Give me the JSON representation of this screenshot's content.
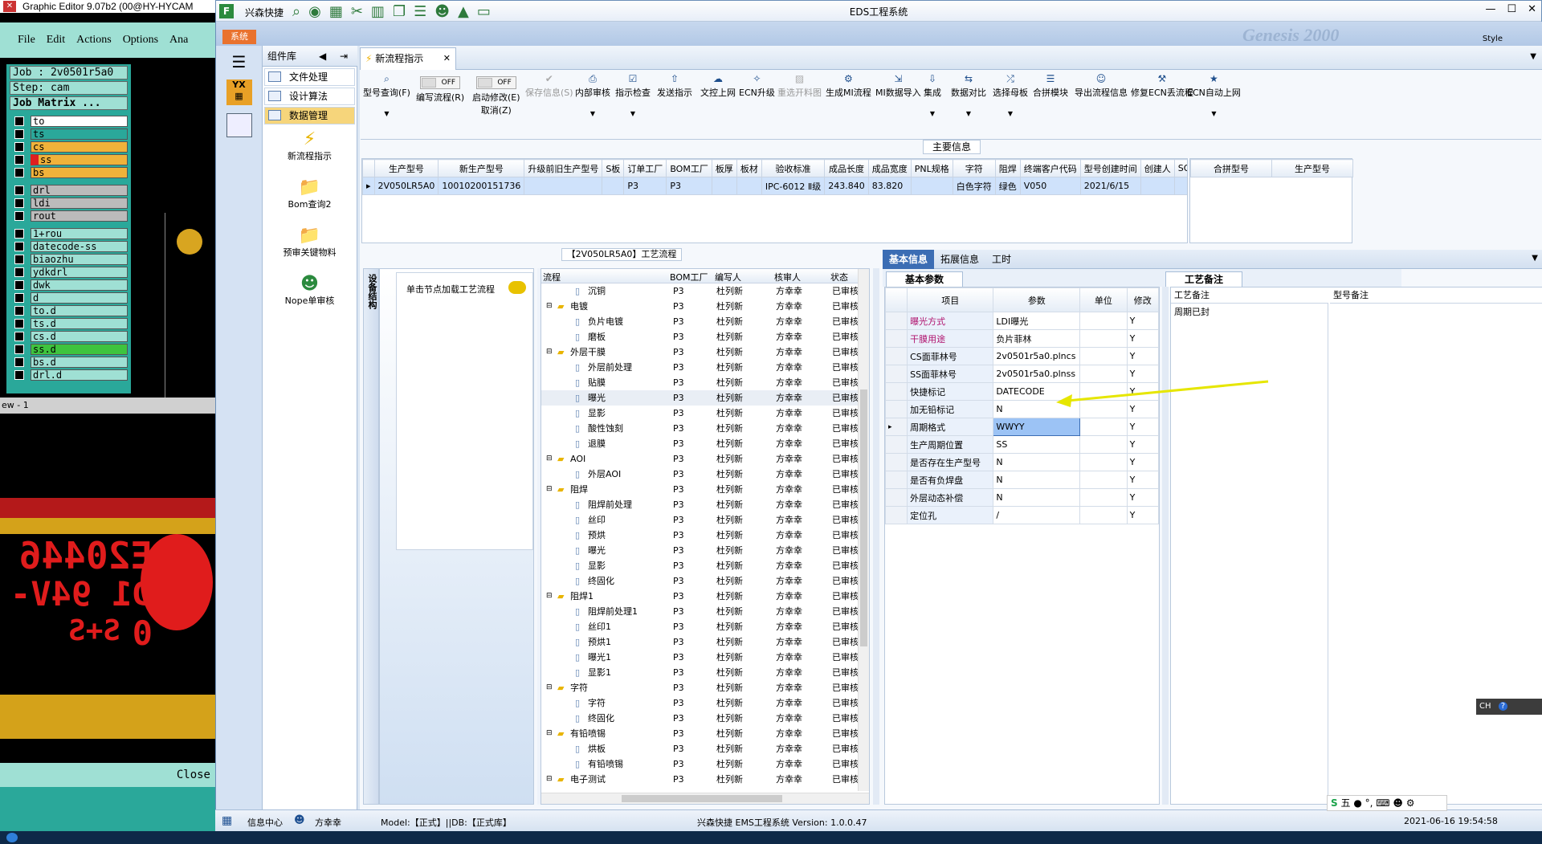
{
  "bg_editor": {
    "title": "Graphic Editor 9.07b2 (00@HY-HYCAM",
    "menu": [
      "File",
      "Edit",
      "Actions",
      "Options",
      "Ana"
    ],
    "job": "Job : 2v0501r5a0",
    "step": "Step: cam",
    "matrix": "Job Matrix ...",
    "layers": [
      "to",
      "ts",
      "cs",
      "ss",
      "bs",
      "drl",
      "ldi",
      "rout",
      "1+rou",
      "datecode-ss",
      "biaozhu",
      "ydkdrl",
      "dwk",
      "d",
      "to.d",
      "ts.d",
      "cs.d",
      "ss.d",
      "bs.d",
      "drl.d"
    ],
    "close": "Close",
    "view_label": "ew - 1",
    "red_text1": "E20446",
    "red_text2": "D1 94V-0",
    "red_text3": "S+S"
  },
  "app": {
    "title": "EDS工程系统",
    "brand": "兴森快捷",
    "menu_tab": "系统",
    "style_label": "Style",
    "component_lib": "组件库",
    "nav": [
      "文件处理",
      "设计算法",
      "数据管理"
    ],
    "comp_items": [
      "新流程指示",
      "Bom查询2",
      "预审关键物料",
      "Nope单审核"
    ],
    "doc_tab": "新流程指示",
    "toolbar": [
      {
        "label": "型号查询(F)",
        "icon": "search-icon"
      },
      {
        "label": "编写流程(R)",
        "icon": "toggle-icon",
        "toggle": "OFF"
      },
      {
        "label": "启动修改(E)",
        "icon": "toggle-icon",
        "toggle": "OFF",
        "sub": "取消(Z)"
      },
      {
        "label": "保存信息(S)",
        "icon": "check-icon",
        "disabled": true
      },
      {
        "label": "内部审核",
        "icon": "print-icon"
      },
      {
        "label": "指示检查",
        "icon": "check-box-icon"
      },
      {
        "label": "发送指示",
        "icon": "upload-icon"
      },
      {
        "label": "文控上网",
        "icon": "cloud-icon"
      },
      {
        "label": "ECN升级",
        "icon": "ecn-icon"
      },
      {
        "label": "重选开料图",
        "icon": "image-icon",
        "disabled": true
      },
      {
        "label": "生成MI流程",
        "icon": "gears-icon"
      },
      {
        "label": "MI数据导入",
        "icon": "import-icon"
      },
      {
        "label": "集成",
        "icon": "download-icon"
      },
      {
        "label": "数据对比",
        "icon": "compare-icon"
      },
      {
        "label": "选择母板",
        "icon": "shuffle-icon"
      },
      {
        "label": "合拼模块",
        "icon": "list-icon"
      },
      {
        "label": "导出流程信息",
        "icon": "smile-icon"
      },
      {
        "label": "修复ECN丢流程",
        "icon": "wrench-icon"
      },
      {
        "label": "ECN自动上网",
        "icon": "star-icon"
      }
    ],
    "main_info_title": "主要信息",
    "main_headers": [
      "生产型号",
      "新生产型号",
      "升级前旧生产型号",
      "S板",
      "订单工厂",
      "BOM工厂",
      "板厚",
      "板材",
      "验收标准",
      "成品长度",
      "成品宽度",
      "PNL规格",
      "字符",
      "阻焊",
      "终端客户代码",
      "型号创建时间",
      "创建人",
      "SO"
    ],
    "main_row": [
      "2V050LR5A0",
      "10010200151736",
      "",
      "",
      "P3",
      "P3",
      "",
      "",
      "IPC-6012 Ⅱ级",
      "243.840",
      "83.820",
      "",
      "白色字符",
      "绿色",
      "V050",
      "2021/6/15",
      "",
      ""
    ],
    "merge_headers": [
      "合拼型号",
      "生产型号"
    ],
    "flow_title": "【2V050LR5A0】工艺流程",
    "side_tab": "设备结构",
    "load_hint": "单击节点加载工艺流程",
    "tree_headers": [
      "流程",
      "BOM工厂",
      "编写人",
      "核审人",
      "状态"
    ],
    "tree_rows": [
      {
        "lvl": 2,
        "name": "沉铜",
        "f": "P3",
        "w": "杜列新",
        "r": "方幸幸",
        "s": "已审核"
      },
      {
        "lvl": 1,
        "name": "电镀",
        "f": "P3",
        "w": "杜列新",
        "r": "方幸幸",
        "s": "已审核"
      },
      {
        "lvl": 2,
        "name": "负片电镀",
        "f": "P3",
        "w": "杜列新",
        "r": "方幸幸",
        "s": "已审核"
      },
      {
        "lvl": 2,
        "name": "磨板",
        "f": "P3",
        "w": "杜列新",
        "r": "方幸幸",
        "s": "已审核"
      },
      {
        "lvl": 1,
        "name": "外层干膜",
        "f": "P3",
        "w": "杜列新",
        "r": "方幸幸",
        "s": "已审核"
      },
      {
        "lvl": 2,
        "name": "外层前处理",
        "f": "P3",
        "w": "杜列新",
        "r": "方幸幸",
        "s": "已审核"
      },
      {
        "lvl": 2,
        "name": "贴膜",
        "f": "P3",
        "w": "杜列新",
        "r": "方幸幸",
        "s": "已审核"
      },
      {
        "lvl": 2,
        "name": "曝光",
        "f": "P3",
        "w": "杜列新",
        "r": "方幸幸",
        "s": "已审核"
      },
      {
        "lvl": 2,
        "name": "显影",
        "f": "P3",
        "w": "杜列新",
        "r": "方幸幸",
        "s": "已审核"
      },
      {
        "lvl": 2,
        "name": "酸性蚀刻",
        "f": "P3",
        "w": "杜列新",
        "r": "方幸幸",
        "s": "已审核"
      },
      {
        "lvl": 2,
        "name": "退膜",
        "f": "P3",
        "w": "杜列新",
        "r": "方幸幸",
        "s": "已审核"
      },
      {
        "lvl": 1,
        "name": "AOI",
        "f": "P3",
        "w": "杜列新",
        "r": "方幸幸",
        "s": "已审核"
      },
      {
        "lvl": 2,
        "name": "外层AOI",
        "f": "P3",
        "w": "杜列新",
        "r": "方幸幸",
        "s": "已审核"
      },
      {
        "lvl": 1,
        "name": "阻焊",
        "f": "P3",
        "w": "杜列新",
        "r": "方幸幸",
        "s": "已审核"
      },
      {
        "lvl": 2,
        "name": "阻焊前处理",
        "f": "P3",
        "w": "杜列新",
        "r": "方幸幸",
        "s": "已审核"
      },
      {
        "lvl": 2,
        "name": "丝印",
        "f": "P3",
        "w": "杜列新",
        "r": "方幸幸",
        "s": "已审核"
      },
      {
        "lvl": 2,
        "name": "预烘",
        "f": "P3",
        "w": "杜列新",
        "r": "方幸幸",
        "s": "已审核"
      },
      {
        "lvl": 2,
        "name": "曝光",
        "f": "P3",
        "w": "杜列新",
        "r": "方幸幸",
        "s": "已审核"
      },
      {
        "lvl": 2,
        "name": "显影",
        "f": "P3",
        "w": "杜列新",
        "r": "方幸幸",
        "s": "已审核"
      },
      {
        "lvl": 2,
        "name": "终固化",
        "f": "P3",
        "w": "杜列新",
        "r": "方幸幸",
        "s": "已审核"
      },
      {
        "lvl": 1,
        "name": "阻焊1",
        "f": "P3",
        "w": "杜列新",
        "r": "方幸幸",
        "s": "已审核"
      },
      {
        "lvl": 2,
        "name": "阻焊前处理1",
        "f": "P3",
        "w": "杜列新",
        "r": "方幸幸",
        "s": "已审核"
      },
      {
        "lvl": 2,
        "name": "丝印1",
        "f": "P3",
        "w": "杜列新",
        "r": "方幸幸",
        "s": "已审核"
      },
      {
        "lvl": 2,
        "name": "预烘1",
        "f": "P3",
        "w": "杜列新",
        "r": "方幸幸",
        "s": "已审核"
      },
      {
        "lvl": 2,
        "name": "曝光1",
        "f": "P3",
        "w": "杜列新",
        "r": "方幸幸",
        "s": "已审核"
      },
      {
        "lvl": 2,
        "name": "显影1",
        "f": "P3",
        "w": "杜列新",
        "r": "方幸幸",
        "s": "已审核"
      },
      {
        "lvl": 1,
        "name": "字符",
        "f": "P3",
        "w": "杜列新",
        "r": "方幸幸",
        "s": "已审核"
      },
      {
        "lvl": 2,
        "name": "字符",
        "f": "P3",
        "w": "杜列新",
        "r": "方幸幸",
        "s": "已审核"
      },
      {
        "lvl": 2,
        "name": "终固化",
        "f": "P3",
        "w": "杜列新",
        "r": "方幸幸",
        "s": "已审核"
      },
      {
        "lvl": 1,
        "name": "有铅喷锡",
        "f": "P3",
        "w": "杜列新",
        "r": "方幸幸",
        "s": "已审核"
      },
      {
        "lvl": 2,
        "name": "烘板",
        "f": "P3",
        "w": "杜列新",
        "r": "方幸幸",
        "s": "已审核"
      },
      {
        "lvl": 2,
        "name": "有铅喷锡",
        "f": "P3",
        "w": "杜列新",
        "r": "方幸幸",
        "s": "已审核"
      },
      {
        "lvl": 1,
        "name": "电子测试",
        "f": "P3",
        "w": "杜列新",
        "r": "方幸幸",
        "s": "已审核"
      }
    ],
    "info_tabs": [
      "基本信息",
      "拓展信息",
      "工时"
    ],
    "basic_params_tab": "基本参数",
    "param_headers": [
      "项目",
      "参数",
      "单位",
      "修改"
    ],
    "params": [
      {
        "item": "曝光方式",
        "val": "LDI曝光",
        "unit": "",
        "mod": "Y",
        "pink": true
      },
      {
        "item": "干膜用途",
        "val": "负片菲林",
        "unit": "",
        "mod": "Y",
        "pink": true
      },
      {
        "item": "CS面菲林号",
        "val": "2v0501r5a0.plncs",
        "unit": "",
        "mod": "Y"
      },
      {
        "item": "SS面菲林号",
        "val": "2v0501r5a0.plnss",
        "unit": "",
        "mod": "Y"
      },
      {
        "item": "快捷标记",
        "val": "DATECODE",
        "unit": "",
        "mod": "Y"
      },
      {
        "item": "加无铅标记",
        "val": "N",
        "unit": "",
        "mod": "Y"
      },
      {
        "item": "周期格式",
        "val": "WWYY",
        "unit": "",
        "mod": "Y",
        "selected": true
      },
      {
        "item": "生产周期位置",
        "val": "SS",
        "unit": "",
        "mod": "Y"
      },
      {
        "item": "是否存在生产型号",
        "val": "N",
        "unit": "",
        "mod": "Y"
      },
      {
        "item": "是否有负焊盘",
        "val": "N",
        "unit": "",
        "mod": "Y"
      },
      {
        "item": "外层动态补偿",
        "val": "N",
        "unit": "",
        "mod": "Y"
      },
      {
        "item": "定位孔",
        "val": "/",
        "unit": "",
        "mod": "Y"
      }
    ],
    "process_note_tab": "工艺备注",
    "note_headers": [
      "工艺备注",
      "型号备注"
    ],
    "note_text": "周期已封",
    "status": {
      "info_center": "信息中心",
      "user": "方幸幸",
      "model": "Model:【正式】||DB:【正式库】",
      "version": "兴森快捷 EMS工程系统 Version: 1.0.0.47",
      "datetime": "2021-06-16 19:54:58"
    },
    "ime": {
      "lang": "CH",
      "mode": "五"
    }
  },
  "colors": {
    "accent": "#3b6db4",
    "pink_label": "#b0126e",
    "selected_row": "#cfe2fb",
    "sel_cell": "#9cc3f5"
  }
}
